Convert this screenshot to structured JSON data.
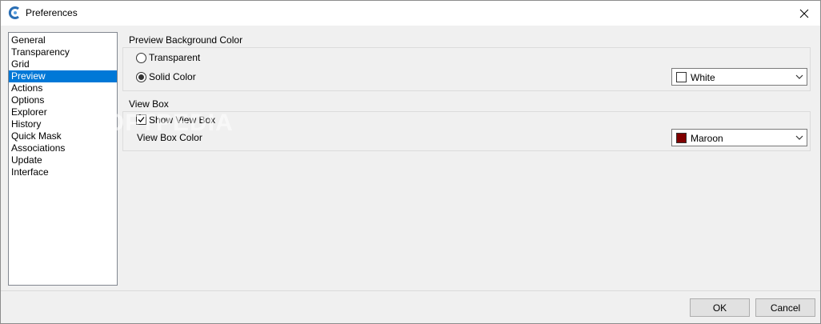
{
  "window": {
    "title": "Preferences"
  },
  "nav": {
    "items": [
      {
        "label": "General"
      },
      {
        "label": "Transparency"
      },
      {
        "label": "Grid"
      },
      {
        "label": "Preview",
        "selected": true
      },
      {
        "label": "Actions"
      },
      {
        "label": "Options"
      },
      {
        "label": "Explorer"
      },
      {
        "label": "History"
      },
      {
        "label": "Quick Mask"
      },
      {
        "label": "Associations"
      },
      {
        "label": "Update"
      },
      {
        "label": "Interface"
      }
    ]
  },
  "preview_bg": {
    "title": "Preview Background Color",
    "transparent_label": "Transparent",
    "solid_label": "Solid Color",
    "selected_option": "Solid Color",
    "color_select": {
      "value": "White",
      "swatch": "#ffffff"
    }
  },
  "view_box": {
    "title": "View Box",
    "show_label": "Show View Box",
    "show_checked": true,
    "color_label": "View Box Color",
    "color_select": {
      "value": "Maroon",
      "swatch": "#800000"
    }
  },
  "buttons": {
    "ok": "OK",
    "cancel": "Cancel"
  },
  "watermark": "SOFTPEDIA",
  "colors": {
    "selection": "#0078d7"
  }
}
